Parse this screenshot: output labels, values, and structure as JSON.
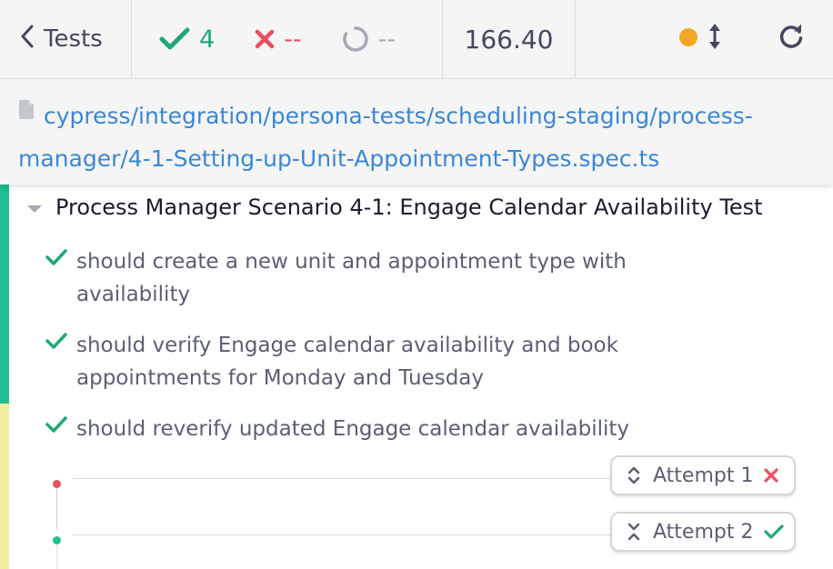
{
  "header": {
    "back_label": "Tests",
    "passed": "4",
    "failed": "--",
    "pending": "--",
    "duration": "166.40"
  },
  "spec": {
    "path": "cypress/integration/persona-tests/scheduling-staging/process-manager/4-1-Setting-up-Unit-Appointment-Types.spec.ts"
  },
  "suite": {
    "title": "Process Manager Scenario 4-1: Engage Calendar Availability Test",
    "tests": [
      {
        "label": "should create a new unit and appointment type with availability",
        "status": "passed"
      },
      {
        "label": "should verify Engage calendar availability and book appointments for Monday and Tuesday",
        "status": "passed"
      },
      {
        "label": "should reverify updated Engage calendar availability",
        "status": "passed"
      }
    ]
  },
  "attempts": [
    {
      "label": "Attempt 1",
      "result": "failed"
    },
    {
      "label": "Attempt 2",
      "result": "passed"
    }
  ],
  "colors": {
    "passed": "#1fa971",
    "failed": "#e94f5f",
    "link": "#3b87d6",
    "running": "#f5a623"
  }
}
